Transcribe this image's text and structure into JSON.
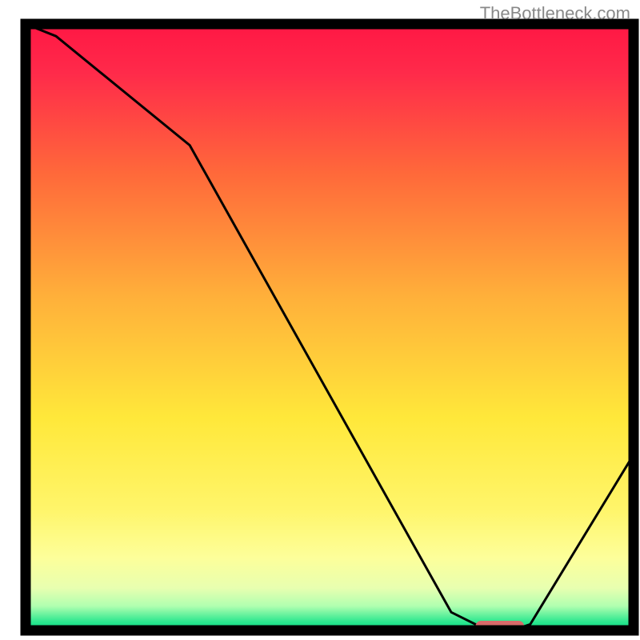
{
  "watermark": "TheBottleneck.com",
  "chart_data": {
    "type": "line",
    "title": "",
    "xlabel": "",
    "ylabel": "",
    "xlim": [
      0,
      100
    ],
    "ylim": [
      0,
      100
    ],
    "x": [
      0,
      5,
      27,
      70,
      76,
      80,
      83,
      100
    ],
    "values": [
      100,
      98,
      80,
      3,
      0,
      0,
      1,
      29
    ],
    "marker": {
      "x_start": 74,
      "x_end": 82,
      "y": 0
    },
    "background_gradient": {
      "stops": [
        {
          "offset": 0.0,
          "color": "#ff1744"
        },
        {
          "offset": 0.08,
          "color": "#ff2a4a"
        },
        {
          "offset": 0.25,
          "color": "#ff6a3a"
        },
        {
          "offset": 0.45,
          "color": "#ffb03a"
        },
        {
          "offset": 0.65,
          "color": "#ffe83a"
        },
        {
          "offset": 0.8,
          "color": "#fff56a"
        },
        {
          "offset": 0.88,
          "color": "#fdff9a"
        },
        {
          "offset": 0.93,
          "color": "#e8ffb0"
        },
        {
          "offset": 0.96,
          "color": "#b0ffb0"
        },
        {
          "offset": 0.985,
          "color": "#30e890"
        },
        {
          "offset": 1.0,
          "color": "#00d880"
        }
      ]
    },
    "frame_color": "#000000",
    "line_color": "#000000",
    "marker_color": "#d86a6a"
  }
}
